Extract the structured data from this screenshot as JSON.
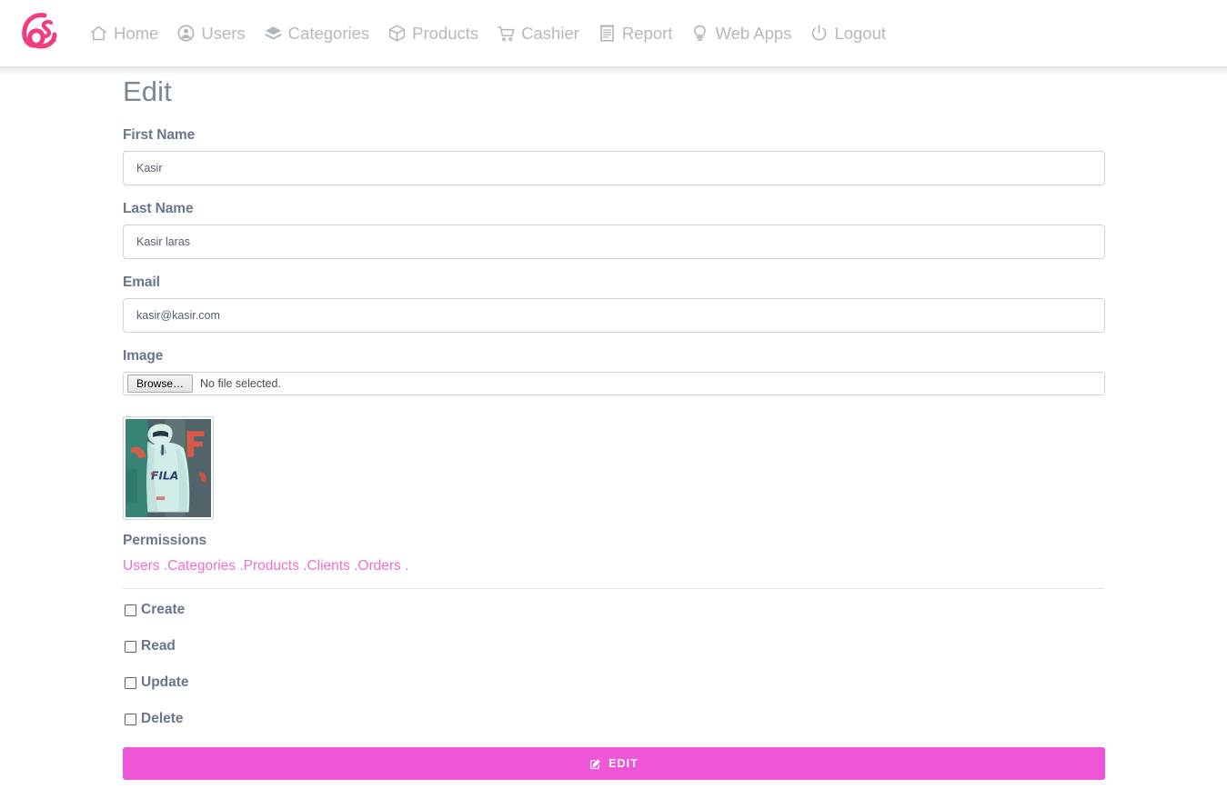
{
  "brand": {
    "logo_text": "Ls",
    "logo_color": "#ef3d7f"
  },
  "nav": {
    "items": [
      {
        "label": "Home",
        "icon": "home-icon"
      },
      {
        "label": "Users",
        "icon": "user-circle-icon"
      },
      {
        "label": "Categories",
        "icon": "layers-icon"
      },
      {
        "label": "Products",
        "icon": "cube-icon"
      },
      {
        "label": "Cashier",
        "icon": "shopping-cart-icon"
      },
      {
        "label": "Report",
        "icon": "receipt-icon"
      },
      {
        "label": "Web Apps",
        "icon": "lightbulb-icon"
      },
      {
        "label": "Logout",
        "icon": "power-icon"
      }
    ]
  },
  "page": {
    "title": "Edit"
  },
  "form": {
    "first_name": {
      "label": "First Name",
      "value": "Kasir",
      "placeholder": "First Name"
    },
    "last_name": {
      "label": "Last Name",
      "value": "Kasir laras",
      "placeholder": "Last Name"
    },
    "email": {
      "label": "Email",
      "value": "kasir@kasir.com",
      "placeholder": "Email"
    },
    "image": {
      "label": "Image",
      "browse_label": "Browse…",
      "file_status": "No file selected.",
      "thumbnail_alt": "user-avatar"
    },
    "permissions": {
      "label": "Permissions",
      "assigned": [
        "Users .",
        "Categories .",
        "Products .",
        "Clients .",
        "Orders ."
      ],
      "assigned_text": "Users .Categories .Products .Clients .Orders .",
      "color": "#f26ecd"
    },
    "checkboxes": [
      {
        "label": "Create",
        "checked": false
      },
      {
        "label": "Read",
        "checked": false
      },
      {
        "label": "Update",
        "checked": false
      },
      {
        "label": "Delete",
        "checked": false
      }
    ],
    "submit": {
      "label": "Edit",
      "icon": "edit-square-icon",
      "color": "#ef55d7"
    }
  }
}
